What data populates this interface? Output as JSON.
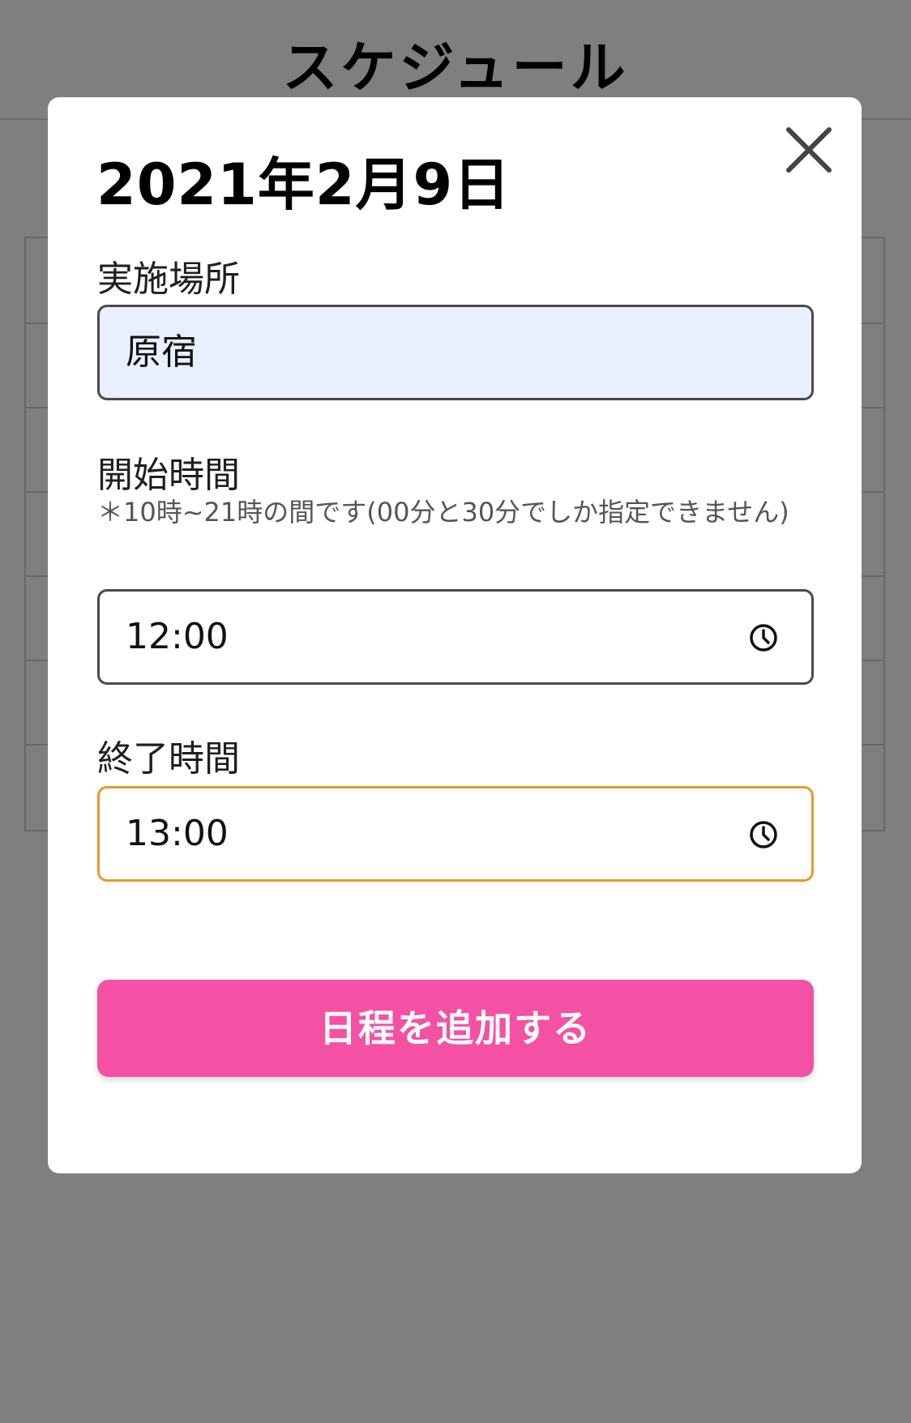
{
  "app": {
    "title": "スケジュール"
  },
  "modal": {
    "date": "2021年2月9日",
    "location": {
      "label": "実施場所",
      "value": "原宿"
    },
    "start_time": {
      "label": "開始時間",
      "note": "＊10時~21時の間です(00分と30分でしか指定できません)",
      "value": "12:00"
    },
    "end_time": {
      "label": "終了時間",
      "value": "13:00"
    },
    "submit_label": "日程を追加する",
    "icons": {
      "close": "close-icon",
      "clock": "clock-icon"
    }
  },
  "colors": {
    "accent": "#f451a4",
    "focus": "#e8982d",
    "autofill": "#e8f0fe"
  }
}
